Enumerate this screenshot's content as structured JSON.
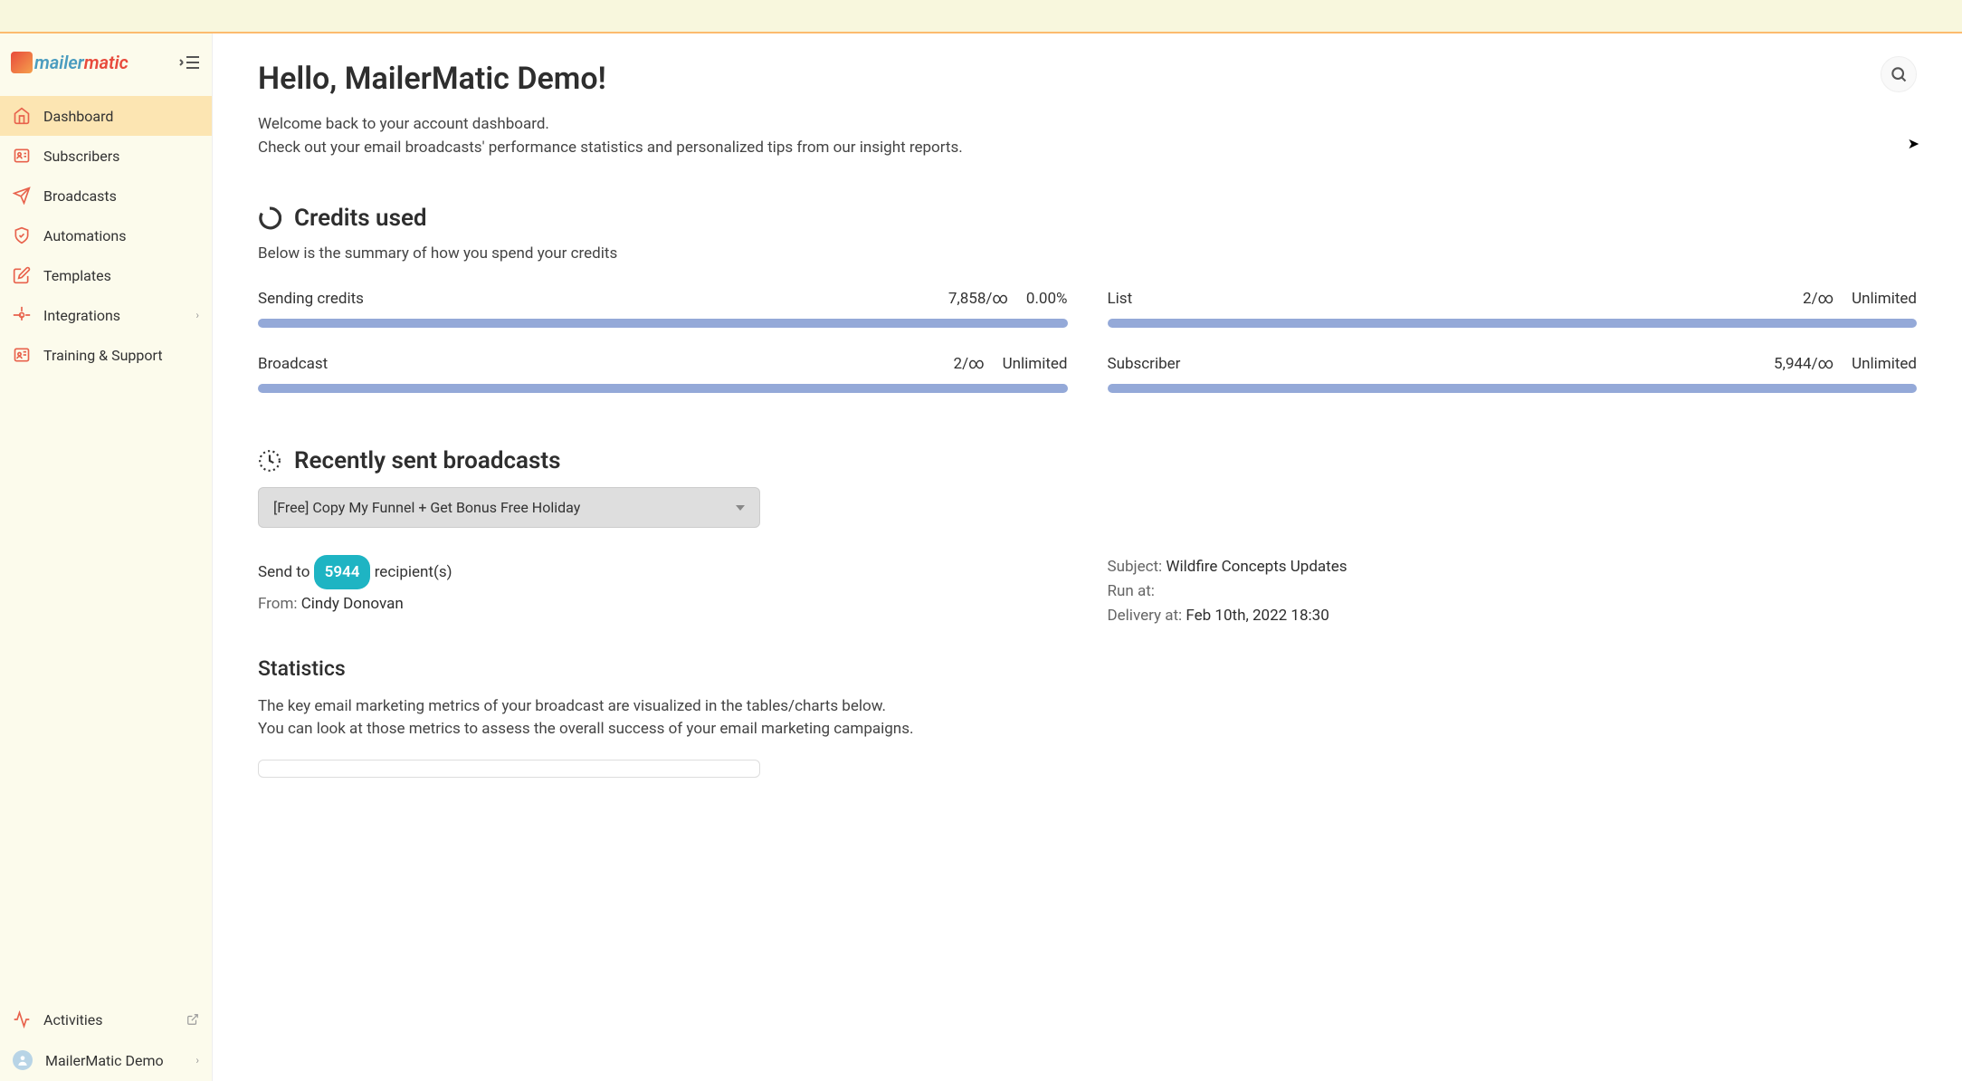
{
  "logo": {
    "text_part1": "mailer",
    "text_part2": "matic"
  },
  "sidebar": {
    "items": [
      {
        "label": "Dashboard",
        "icon": "home-icon",
        "active": true
      },
      {
        "label": "Subscribers",
        "icon": "users-icon"
      },
      {
        "label": "Broadcasts",
        "icon": "send-icon"
      },
      {
        "label": "Automations",
        "icon": "shield-check-icon"
      },
      {
        "label": "Templates",
        "icon": "edit-icon"
      },
      {
        "label": "Integrations",
        "icon": "refresh-icon",
        "chevron": true
      },
      {
        "label": "Training & Support",
        "icon": "book-icon"
      }
    ],
    "bottom": {
      "activities": "Activities",
      "user": "MailerMatic Demo"
    }
  },
  "header": {
    "title": "Hello, MailerMatic Demo!",
    "welcome_line1": "Welcome back to your account dashboard.",
    "welcome_line2": "Check out your email broadcasts' performance statistics and personalized tips from our insight reports."
  },
  "credits": {
    "title": "Credits used",
    "subtitle": "Below is the summary of how you spend your credits",
    "items": [
      {
        "label": "Sending credits",
        "count": "7,858/∞",
        "status": "0.00%"
      },
      {
        "label": "List",
        "count": "2/∞",
        "status": "Unlimited"
      },
      {
        "label": "Broadcast",
        "count": "2/∞",
        "status": "Unlimited"
      },
      {
        "label": "Subscriber",
        "count": "5,944/∞",
        "status": "Unlimited"
      }
    ]
  },
  "broadcasts": {
    "title": "Recently sent broadcasts",
    "selected": "[Free] Copy My Funnel + Get Bonus Free Holiday",
    "send_to_prefix": "Send to",
    "recipients_count": "5944",
    "recipients_suffix": "recipient(s)",
    "from_label": "From:",
    "from_value": "Cindy Donovan",
    "subject_label": "Subject:",
    "subject_value": "Wildfire Concepts Updates",
    "run_at_label": "Run at:",
    "run_at_value": "",
    "delivery_label": "Delivery at:",
    "delivery_value": "Feb 10th, 2022 18:30"
  },
  "statistics": {
    "title": "Statistics",
    "line1": "The key email marketing metrics of your broadcast are visualized in the tables/charts below.",
    "line2": "You can look at those metrics to assess the overall success of your email marketing campaigns."
  }
}
